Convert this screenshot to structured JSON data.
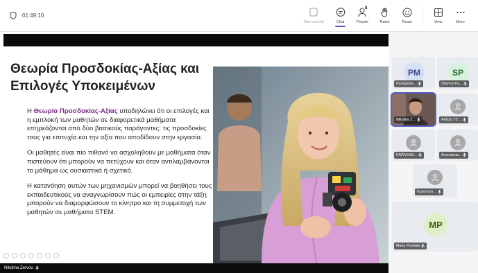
{
  "meeting": {
    "timer": "01:49:10"
  },
  "toolbar": {
    "take_control": "Take control",
    "chat": "Chat",
    "people": "People",
    "people_count": "8",
    "raise": "Raise",
    "react": "React",
    "view": "View",
    "more": "More"
  },
  "slide": {
    "title": "Θεωρία Προσδοκίας-Αξίας και Επιλογές Υποκειμένων",
    "p1_prefix": "Η ",
    "p1_highlight": "Θεωρία Προσδοκίας-Αξίας",
    "p1_rest": " υποδηλώνει ότι οι επιλογές και η εμπλοκή των μαθητών σε διαφορετικά μαθήματα επηρεάζονται από δύο βασικούς παράγοντες: τις προσδοκίες τους για επιτυχία και την αξία που αποδίδουν στην εργασία.",
    "p2": "Οι μαθητές είναι πιο πιθανό να ασχοληθούν με μαθήματα όταν πιστεύουν ότι μπορούν να πετύχουν και όταν αντιλαμβάνονται το μάθημα ως ουσιαστικό ή σχετικό.",
    "p3": "Η κατανόηση αυτών των μηχανισμών μπορεί να βοηθήσει τους εκπαιδευτικούς να αναγνωρίσουν πώς οι εμπειρίες στην τάξη μπορούν να διαμορφώσουν το κίνητρο και τη συμμετοχή των μαθητών σε μαθήματα STEM."
  },
  "presenter": {
    "name": "Nikolina Zervou"
  },
  "participants": [
    {
      "name": "Panagiotis...",
      "initials": "PM"
    },
    {
      "name": "Stavros Pa...",
      "initials": "SP"
    },
    {
      "name": "Nikolina Z...",
      "initials": ""
    },
    {
      "name": "Αλέξης ΤΖ...",
      "initials": ""
    },
    {
      "name": "ΚΑΡΑΛΑΜ...",
      "initials": ""
    },
    {
      "name": "Αναστασια...",
      "initials": ""
    },
    {
      "name": "Κωνσταντ...",
      "initials": ""
    },
    {
      "name": "Maria Prentaki",
      "initials": "MP"
    }
  ],
  "colors": {
    "accent": "#5b5fc7",
    "highlight_text": "#7a2d8e"
  }
}
